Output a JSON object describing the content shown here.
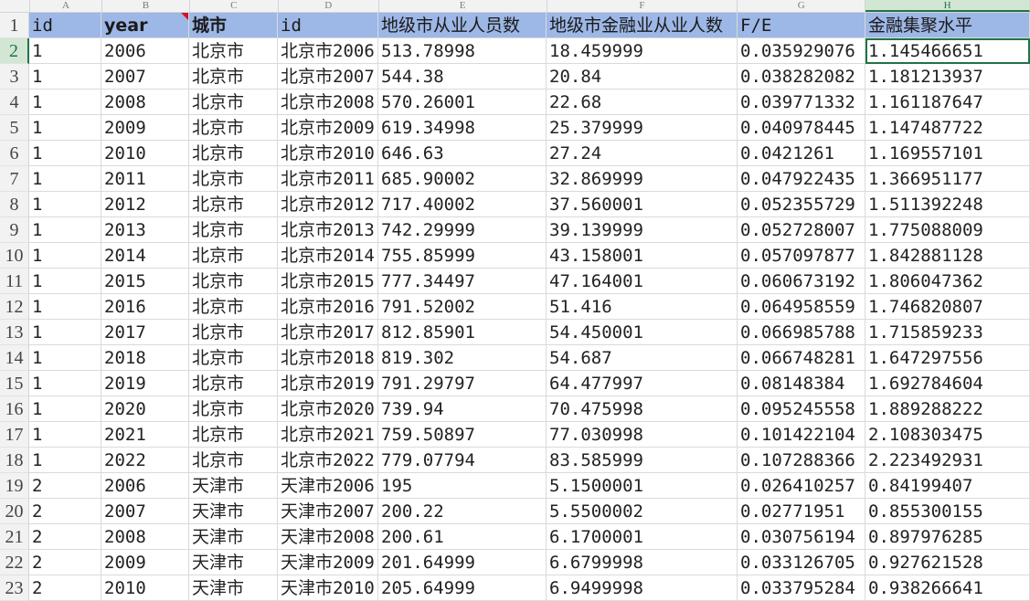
{
  "columns": [
    "A",
    "B",
    "C",
    "D",
    "E",
    "F",
    "G",
    "H"
  ],
  "selected_column": "H",
  "header_row": {
    "row_number": "1",
    "cells": [
      "id",
      "year",
      "城市",
      "id",
      "地级市从业人员数",
      "地级市金融业从业人数",
      "F/E",
      "金融集聚水平"
    ]
  },
  "rows": [
    {
      "n": "2",
      "cells": [
        "1",
        "2006",
        "北京市",
        "北京市2006",
        "513.78998",
        "18.459999",
        "0.035929076",
        "1.145466651"
      ]
    },
    {
      "n": "3",
      "cells": [
        "1",
        "2007",
        "北京市",
        "北京市2007",
        "544.38",
        "20.84",
        "0.038282082",
        "1.181213937"
      ]
    },
    {
      "n": "4",
      "cells": [
        "1",
        "2008",
        "北京市",
        "北京市2008",
        "570.26001",
        "22.68",
        "0.039771332",
        "1.161187647"
      ]
    },
    {
      "n": "5",
      "cells": [
        "1",
        "2009",
        "北京市",
        "北京市2009",
        "619.34998",
        "25.379999",
        "0.040978445",
        "1.147487722"
      ]
    },
    {
      "n": "6",
      "cells": [
        "1",
        "2010",
        "北京市",
        "北京市2010",
        "646.63",
        "27.24",
        "0.0421261",
        "1.169557101"
      ]
    },
    {
      "n": "7",
      "cells": [
        "1",
        "2011",
        "北京市",
        "北京市2011",
        "685.90002",
        "32.869999",
        "0.047922435",
        "1.366951177"
      ]
    },
    {
      "n": "8",
      "cells": [
        "1",
        "2012",
        "北京市",
        "北京市2012",
        "717.40002",
        "37.560001",
        "0.052355729",
        "1.511392248"
      ]
    },
    {
      "n": "9",
      "cells": [
        "1",
        "2013",
        "北京市",
        "北京市2013",
        "742.29999",
        "39.139999",
        "0.052728007",
        "1.775088009"
      ]
    },
    {
      "n": "10",
      "cells": [
        "1",
        "2014",
        "北京市",
        "北京市2014",
        "755.85999",
        "43.158001",
        "0.057097877",
        "1.842881128"
      ]
    },
    {
      "n": "11",
      "cells": [
        "1",
        "2015",
        "北京市",
        "北京市2015",
        "777.34497",
        "47.164001",
        "0.060673192",
        "1.806047362"
      ]
    },
    {
      "n": "12",
      "cells": [
        "1",
        "2016",
        "北京市",
        "北京市2016",
        "791.52002",
        "51.416",
        "0.064958559",
        "1.746820807"
      ]
    },
    {
      "n": "13",
      "cells": [
        "1",
        "2017",
        "北京市",
        "北京市2017",
        "812.85901",
        "54.450001",
        "0.066985788",
        "1.715859233"
      ]
    },
    {
      "n": "14",
      "cells": [
        "1",
        "2018",
        "北京市",
        "北京市2018",
        "819.302",
        "54.687",
        "0.066748281",
        "1.647297556"
      ]
    },
    {
      "n": "15",
      "cells": [
        "1",
        "2019",
        "北京市",
        "北京市2019",
        "791.29797",
        "64.477997",
        "0.08148384",
        "1.692784604"
      ]
    },
    {
      "n": "16",
      "cells": [
        "1",
        "2020",
        "北京市",
        "北京市2020",
        "739.94",
        "70.475998",
        "0.095245558",
        "1.889288222"
      ]
    },
    {
      "n": "17",
      "cells": [
        "1",
        "2021",
        "北京市",
        "北京市2021",
        "759.50897",
        "77.030998",
        "0.101422104",
        "2.108303475"
      ]
    },
    {
      "n": "18",
      "cells": [
        "1",
        "2022",
        "北京市",
        "北京市2022",
        "779.07794",
        "83.585999",
        "0.107288366",
        "2.223492931"
      ]
    },
    {
      "n": "19",
      "cells": [
        "2",
        "2006",
        "天津市",
        "天津市2006",
        "195",
        "5.1500001",
        "0.026410257",
        "0.84199407"
      ]
    },
    {
      "n": "20",
      "cells": [
        "2",
        "2007",
        "天津市",
        "天津市2007",
        "200.22",
        "5.5500002",
        "0.02771951",
        "0.855300155"
      ]
    },
    {
      "n": "21",
      "cells": [
        "2",
        "2008",
        "天津市",
        "天津市2008",
        "200.61",
        "6.1700001",
        "0.030756194",
        "0.897976285"
      ]
    },
    {
      "n": "22",
      "cells": [
        "2",
        "2009",
        "天津市",
        "天津市2009",
        "201.64999",
        "6.6799998",
        "0.033126705",
        "0.927621528"
      ]
    },
    {
      "n": "23",
      "cells": [
        "2",
        "2010",
        "天津市",
        "天津市2010",
        "205.64999",
        "6.9499998",
        "0.033795284",
        "0.938266641"
      ]
    }
  ],
  "active_cell": {
    "row": "2",
    "col": "H"
  },
  "colors": {
    "header_fill": "#9db7e6",
    "selection": "#217346",
    "comment_marker": "#d3112b"
  }
}
